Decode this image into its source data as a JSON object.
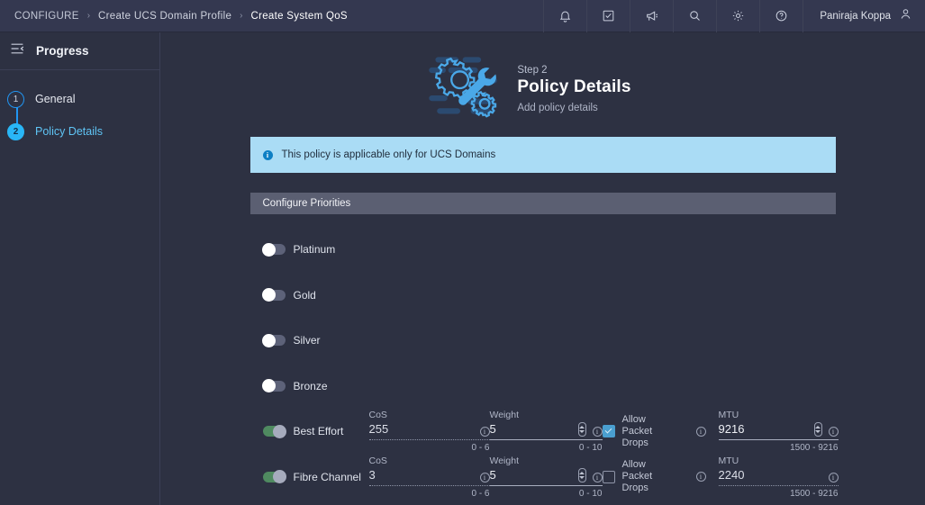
{
  "topbar": {
    "breadcrumbs": [
      "CONFIGURE",
      "Create UCS Domain Profile",
      "Create System QoS"
    ],
    "separator": "›",
    "icons": [
      {
        "name": "bell-icon",
        "title": "Alarms"
      },
      {
        "name": "task-checkbox-icon",
        "title": "Tasks"
      },
      {
        "name": "megaphone-icon",
        "title": "Announcements"
      },
      {
        "name": "search-icon",
        "title": "Search"
      },
      {
        "name": "gear-icon",
        "title": "Settings"
      },
      {
        "name": "help-circle-icon",
        "title": "Help"
      }
    ],
    "user_name": "Paniraja Koppa",
    "user_icon": "person-icon"
  },
  "sidebar": {
    "collapse_icon": "collapse-panel-icon",
    "title": "Progress",
    "steps": [
      {
        "number": "1",
        "label": "General",
        "state": "todo"
      },
      {
        "number": "2",
        "label": "Policy Details",
        "state": "active"
      }
    ]
  },
  "page": {
    "illustration_icon": "gear-wrench-icon",
    "step_kicker": "Step 2",
    "title": "Policy Details",
    "subtitle": "Add policy details",
    "info_banner": {
      "icon": "info-icon",
      "text": "This policy is applicable only for UCS Domains"
    },
    "section_title": "Configure Priorities"
  },
  "labels": {
    "cos": "CoS",
    "weight": "Weight",
    "mtu": "MTU",
    "allow_packet_drops": "Allow Packet Drops",
    "stepper_icon": "stepper-up-down-icon",
    "info_icon": "info-circle-icon"
  },
  "priorities": [
    {
      "name": "Platinum",
      "enabled": false,
      "detailed": false
    },
    {
      "name": "Gold",
      "enabled": false,
      "detailed": false
    },
    {
      "name": "Silver",
      "enabled": false,
      "detailed": false
    },
    {
      "name": "Bronze",
      "enabled": false,
      "detailed": false
    },
    {
      "name": "Best Effort",
      "enabled": true,
      "detailed": true,
      "cos": {
        "value": "255",
        "hint": "0 - 6",
        "editable": false
      },
      "weight": {
        "value": "5",
        "hint": "0 - 10",
        "editable": true
      },
      "mtu": {
        "value": "9216",
        "hint": "1500 - 9216",
        "editable": true
      },
      "allow_packet_drops": {
        "checked": true,
        "disabled": true
      }
    },
    {
      "name": "Fibre Channel",
      "enabled": true,
      "detailed": true,
      "cos": {
        "value": "3",
        "hint": "0 - 6",
        "editable": false
      },
      "weight": {
        "value": "5",
        "hint": "0 - 10",
        "editable": true
      },
      "mtu": {
        "value": "2240",
        "hint": "1500 - 9216",
        "editable": false
      },
      "allow_packet_drops": {
        "checked": false,
        "disabled": true
      }
    }
  ],
  "colors": {
    "background": "#2d3142",
    "topbar": "#343850",
    "accent_blue": "#29b6f6",
    "banner_bg": "#aadcf5",
    "section_bar": "#5b5f72",
    "toggle_on": "#4f8a60",
    "toggle_off": "#5d6279",
    "checkbox_on": "#4a9fd0"
  }
}
